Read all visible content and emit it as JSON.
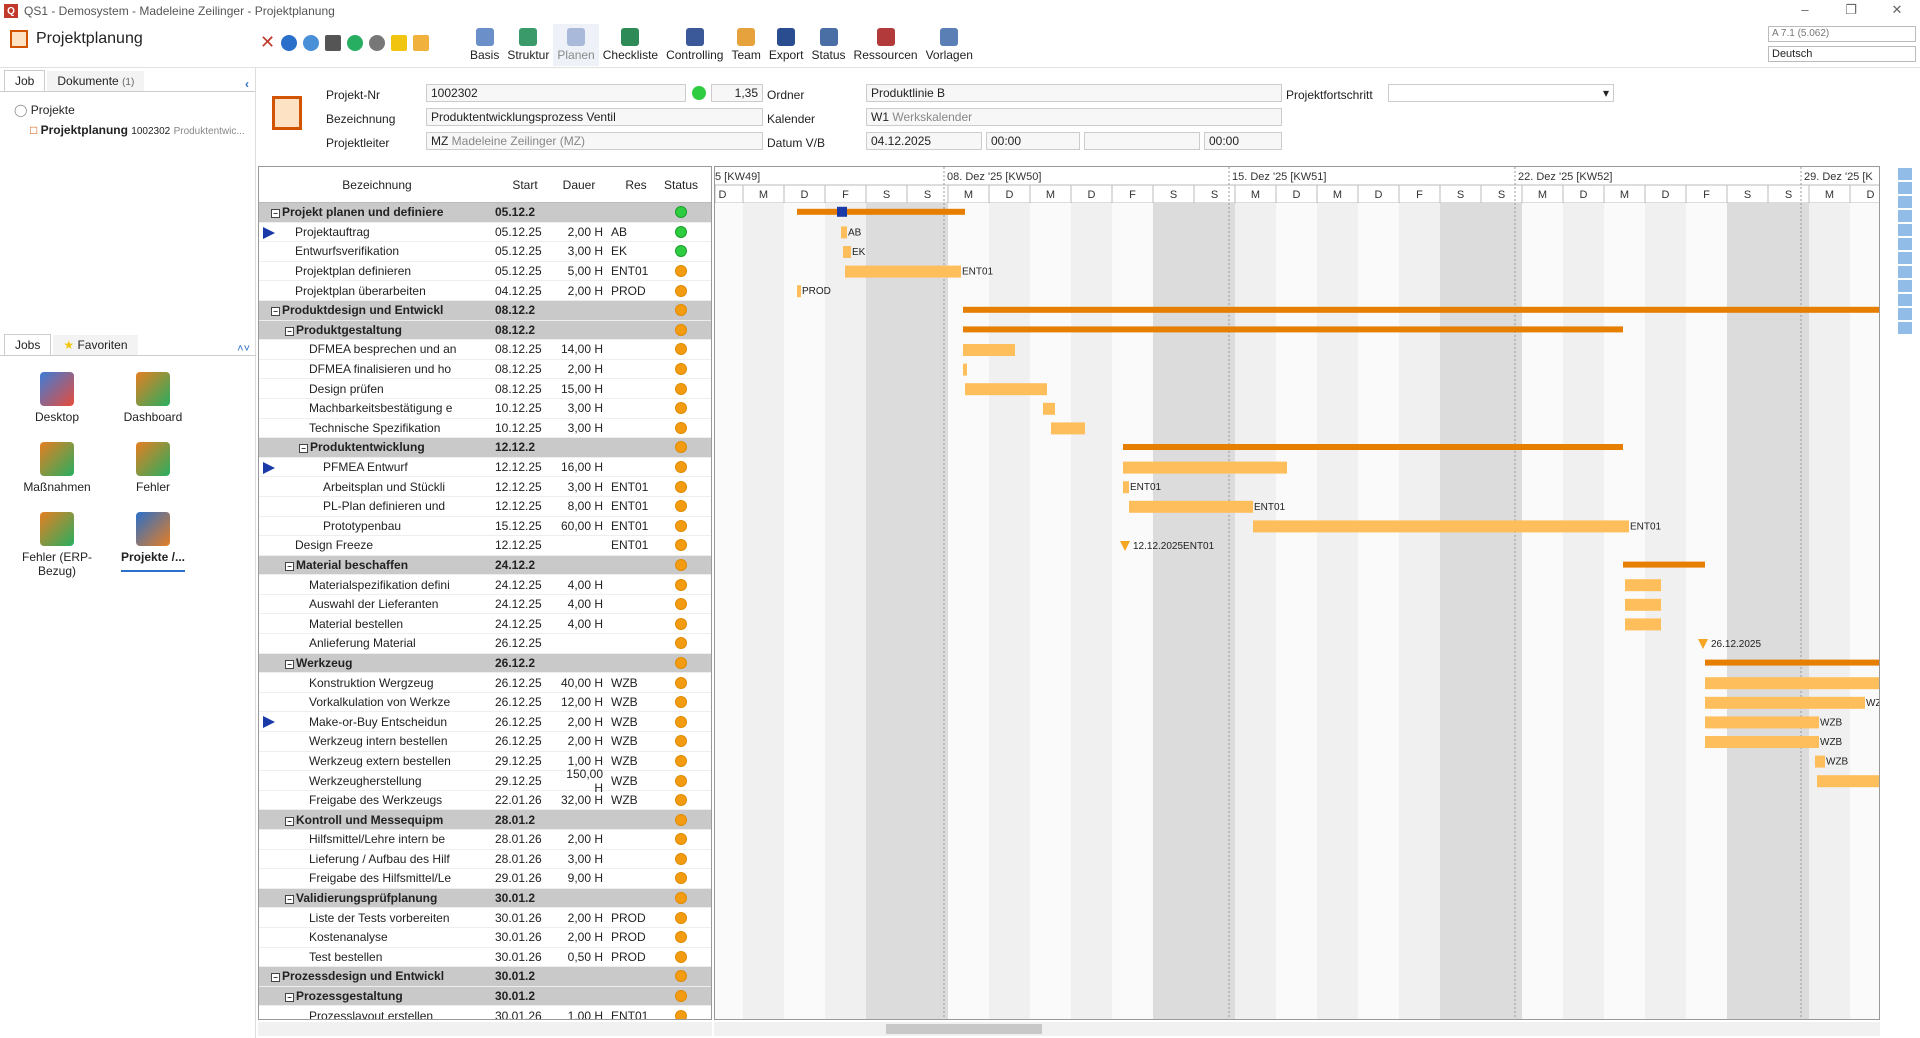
{
  "window": {
    "title": "QS1 - Demosystem - Madeleine Zeilinger - Projektplanung",
    "version": "A 7.1 (5.062)",
    "language": "Deutsch"
  },
  "app": {
    "title": "Projektplanung"
  },
  "ribbon": [
    {
      "label": "Basis"
    },
    {
      "label": "Struktur"
    },
    {
      "label": "Planen"
    },
    {
      "label": "Checkliste"
    },
    {
      "label": "Controlling"
    },
    {
      "label": "Team"
    },
    {
      "label": "Export"
    },
    {
      "label": "Status"
    },
    {
      "label": "Ressourcen"
    },
    {
      "label": "Vorlagen"
    }
  ],
  "left_panel": {
    "tab_job": "Job",
    "tab_docs": "Dokumente",
    "docs_count": "(1)",
    "tree_root": "Projekte",
    "tree_item": "Projektplanung",
    "tree_item_id": "1002302",
    "tree_item_sub": "Produktentwic...",
    "jobs_tab": "Jobs",
    "fav_tab": "Favoriten",
    "tiles": [
      "Desktop",
      "Dashboard",
      "Maßnahmen",
      "Fehler",
      "Fehler (ERP-Bezug)",
      "Projekte /..."
    ]
  },
  "form": {
    "projekt_nr_label": "Projekt-Nr",
    "projekt_nr": "1002302",
    "progress_value": "1,35",
    "ordner_label": "Ordner",
    "ordner": "Produktlinie B",
    "fortschritt_label": "Projektfortschritt",
    "bezeichnung_label": "Bezeichnung",
    "bezeichnung": "Produktentwicklungsprozess Ventil",
    "kalender_label": "Kalender",
    "kalender_code": "W1",
    "kalender_name": "Werkskalender",
    "leiter_label": "Projektleiter",
    "leiter_code": "MZ",
    "leiter_name": "Madeleine Zeilinger (MZ)",
    "datum_label": "Datum V/B",
    "datum_v": "04.12.2025",
    "time_v": "00:00",
    "time_b": "00:00"
  },
  "grid": {
    "headers": {
      "name": "Bezeichnung",
      "start": "Start",
      "dur": "Dauer",
      "res": "Res",
      "status": "Status"
    },
    "rows": [
      {
        "name": "Projekt planen und definiere",
        "start": "05.12.2",
        "dur": "",
        "res": "",
        "level": 0,
        "group": true,
        "status": "green-play"
      },
      {
        "name": "Projektauftrag",
        "start": "05.12.25",
        "dur": "2,00 H",
        "res": "AB",
        "level": 1,
        "flag": true,
        "status": "green-check"
      },
      {
        "name": "Entwurfsverifikation",
        "start": "05.12.25",
        "dur": "3,00 H",
        "res": "EK",
        "level": 1,
        "status": "green-play"
      },
      {
        "name": "Projektplan definieren",
        "start": "05.12.25",
        "dur": "5,00 H",
        "res": "ENT01",
        "level": 1,
        "status": "orange"
      },
      {
        "name": "Projektplan überarbeiten",
        "start": "04.12.25",
        "dur": "2,00 H",
        "res": "PROD",
        "level": 1,
        "status": "orange"
      },
      {
        "name": "Produktdesign und Entwickl",
        "start": "08.12.2",
        "dur": "",
        "res": "",
        "level": 0,
        "group": true,
        "status": "orange"
      },
      {
        "name": "Produktgestaltung",
        "start": "08.12.2",
        "dur": "",
        "res": "",
        "level": 1,
        "group": true,
        "status": "orange"
      },
      {
        "name": "DFMEA besprechen und an",
        "start": "08.12.25",
        "dur": "14,00 H",
        "res": "",
        "level": 2,
        "status": "orange"
      },
      {
        "name": "DFMEA finalisieren und ho",
        "start": "08.12.25",
        "dur": "2,00 H",
        "res": "",
        "level": 2,
        "status": "orange"
      },
      {
        "name": "Design prüfen",
        "start": "08.12.25",
        "dur": "15,00 H",
        "res": "",
        "level": 2,
        "status": "orange"
      },
      {
        "name": "Machbarkeitsbestätigung e",
        "start": "10.12.25",
        "dur": "3,00 H",
        "res": "",
        "level": 2,
        "status": "orange"
      },
      {
        "name": "Technische Spezifikation",
        "start": "10.12.25",
        "dur": "3,00 H",
        "res": "",
        "level": 2,
        "status": "orange"
      },
      {
        "name": "Produktentwicklung",
        "start": "12.12.2",
        "dur": "",
        "res": "",
        "level": 2,
        "group": true,
        "status": "orange"
      },
      {
        "name": "PFMEA Entwurf",
        "start": "12.12.25",
        "dur": "16,00 H",
        "res": "",
        "level": 3,
        "flag": true,
        "status": "orange"
      },
      {
        "name": "Arbeitsplan und Stückli",
        "start": "12.12.25",
        "dur": "3,00 H",
        "res": "ENT01",
        "level": 3,
        "status": "orange"
      },
      {
        "name": "PL-Plan definieren und",
        "start": "12.12.25",
        "dur": "8,00 H",
        "res": "ENT01",
        "level": 3,
        "status": "orange"
      },
      {
        "name": "Prototypenbau",
        "start": "15.12.25",
        "dur": "60,00 H",
        "res": "ENT01",
        "level": 3,
        "status": "orange"
      },
      {
        "name": "Design Freeze",
        "start": "12.12.25",
        "dur": "",
        "res": "ENT01",
        "level": 1,
        "status": "orange"
      },
      {
        "name": "Material beschaffen",
        "start": "24.12.2",
        "dur": "",
        "res": "",
        "level": 1,
        "group": true,
        "status": "orange"
      },
      {
        "name": "Materialspezifikation defini",
        "start": "24.12.25",
        "dur": "4,00 H",
        "res": "",
        "level": 2,
        "status": "orange"
      },
      {
        "name": "Auswahl der Lieferanten",
        "start": "24.12.25",
        "dur": "4,00 H",
        "res": "",
        "level": 2,
        "status": "orange"
      },
      {
        "name": "Material bestellen",
        "start": "24.12.25",
        "dur": "4,00 H",
        "res": "",
        "level": 2,
        "status": "orange"
      },
      {
        "name": "Anlieferung Material",
        "start": "26.12.25",
        "dur": "",
        "res": "",
        "level": 2,
        "status": "orange"
      },
      {
        "name": "Werkzeug",
        "start": "26.12.2",
        "dur": "",
        "res": "",
        "level": 1,
        "group": true,
        "status": "orange"
      },
      {
        "name": "Konstruktion Wergzeug",
        "start": "26.12.25",
        "dur": "40,00 H",
        "res": "WZB",
        "level": 2,
        "status": "orange"
      },
      {
        "name": "Vorkalkulation von Werkze",
        "start": "26.12.25",
        "dur": "12,00 H",
        "res": "WZB",
        "level": 2,
        "status": "orange"
      },
      {
        "name": "Make-or-Buy Entscheidun",
        "start": "26.12.25",
        "dur": "2,00 H",
        "res": "WZB",
        "level": 2,
        "flag": true,
        "status": "orange"
      },
      {
        "name": "Werkzeug intern bestellen",
        "start": "26.12.25",
        "dur": "2,00 H",
        "res": "WZB",
        "level": 2,
        "status": "orange"
      },
      {
        "name": "Werkzeug extern bestellen",
        "start": "29.12.25",
        "dur": "1,00 H",
        "res": "WZB",
        "level": 2,
        "status": "orange"
      },
      {
        "name": "Werkzeugherstellung",
        "start": "29.12.25",
        "dur": "150,00 H",
        "res": "WZB",
        "level": 2,
        "status": "orange"
      },
      {
        "name": "Freigabe des Werkzeugs",
        "start": "22.01.26",
        "dur": "32,00 H",
        "res": "WZB",
        "level": 2,
        "status": "orange"
      },
      {
        "name": "Kontroll und Messequipm",
        "start": "28.01.2",
        "dur": "",
        "res": "",
        "level": 1,
        "group": true,
        "status": "orange"
      },
      {
        "name": "Hilfsmittel/Lehre intern be",
        "start": "28.01.26",
        "dur": "2,00 H",
        "res": "",
        "level": 2,
        "status": "orange"
      },
      {
        "name": "Lieferung / Aufbau des Hilf",
        "start": "28.01.26",
        "dur": "3,00 H",
        "res": "",
        "level": 2,
        "status": "orange"
      },
      {
        "name": "Freigabe des Hilfsmittel/Le",
        "start": "29.01.26",
        "dur": "9,00 H",
        "res": "",
        "level": 2,
        "status": "orange"
      },
      {
        "name": "Validierungsprüfplanung",
        "start": "30.01.2",
        "dur": "",
        "res": "",
        "level": 1,
        "group": true,
        "status": "orange"
      },
      {
        "name": "Liste der Tests vorbereiten",
        "start": "30.01.26",
        "dur": "2,00 H",
        "res": "PROD",
        "level": 2,
        "status": "orange"
      },
      {
        "name": "Kostenanalyse",
        "start": "30.01.26",
        "dur": "2,00 H",
        "res": "PROD",
        "level": 2,
        "status": "orange"
      },
      {
        "name": "Test bestellen",
        "start": "30.01.26",
        "dur": "0,50 H",
        "res": "PROD",
        "level": 2,
        "status": "orange"
      },
      {
        "name": "Prozessdesign und Entwickl",
        "start": "30.01.2",
        "dur": "",
        "res": "",
        "level": 0,
        "group": true,
        "status": "orange"
      },
      {
        "name": "Prozessgestaltung",
        "start": "30.01.2",
        "dur": "",
        "res": "",
        "level": 1,
        "group": true,
        "status": "orange"
      },
      {
        "name": "Prozesslayout erstellen",
        "start": "30.01.26",
        "dur": "1,00 H",
        "res": "ENT01",
        "level": 2,
        "status": "orange"
      }
    ]
  },
  "gantt": {
    "weeks": [
      "5 [KW49]",
      "08. Dez '25 [KW50]",
      "15. Dez '25 [KW51]",
      "22. Dez '25 [KW52]",
      "29. Dez '25 [K"
    ],
    "days": [
      "D",
      "M",
      "D",
      "F",
      "S",
      "S",
      "M",
      "D",
      "M",
      "D",
      "F",
      "S",
      "S",
      "M",
      "D",
      "M",
      "D",
      "F",
      "S",
      "S",
      "M",
      "D",
      "M",
      "D",
      "F",
      "S",
      "S",
      "M",
      "D"
    ],
    "labels": [
      "AB",
      "EK",
      "ENT01",
      "PROD",
      "ENT01",
      "ENT01",
      "12.12.2025ENT01",
      "ENT01",
      "26.12.2025",
      "WZE",
      "WZB",
      "WZB",
      "WZB"
    ],
    "colors": {
      "summary": "#e67e00",
      "task": "#ffbe5c",
      "weekend": "#dcdcdc",
      "milestone": "#f5a623"
    }
  }
}
